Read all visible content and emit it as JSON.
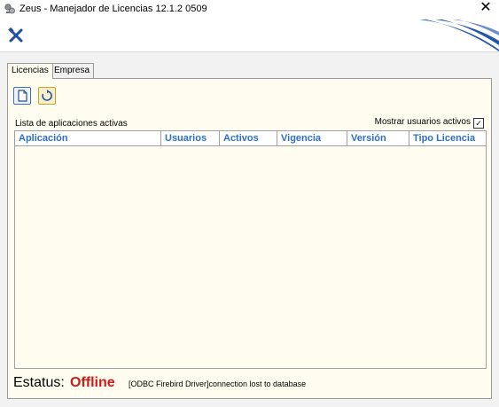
{
  "window": {
    "title": "Zeus - Manejador de Licencias 12.1.2 0509",
    "close_glyph": "✕"
  },
  "toolbar": {
    "icon": "tools-icon",
    "accent_color": "#1e4fa0"
  },
  "tabs": [
    {
      "label": "Licencias",
      "active": true
    },
    {
      "label": "Empresa",
      "active": false
    }
  ],
  "panel": {
    "buttons": [
      {
        "name": "new-document-icon"
      },
      {
        "name": "refresh-icon"
      }
    ],
    "list_label": "Lista de aplicaciones activas",
    "show_users_label": "Mostrar usuarios activos",
    "show_users_checked": true,
    "check_glyph": "✓",
    "columns": [
      "Aplicación",
      "Usuarios",
      "Activos",
      "Vigencia",
      "Versión",
      "Tipo Licencia"
    ],
    "rows": []
  },
  "status": {
    "label": "Estatus:",
    "value": "Offline",
    "value_color": "#d01818",
    "message": "[ODBC Firebird Driver]connection lost to database"
  }
}
